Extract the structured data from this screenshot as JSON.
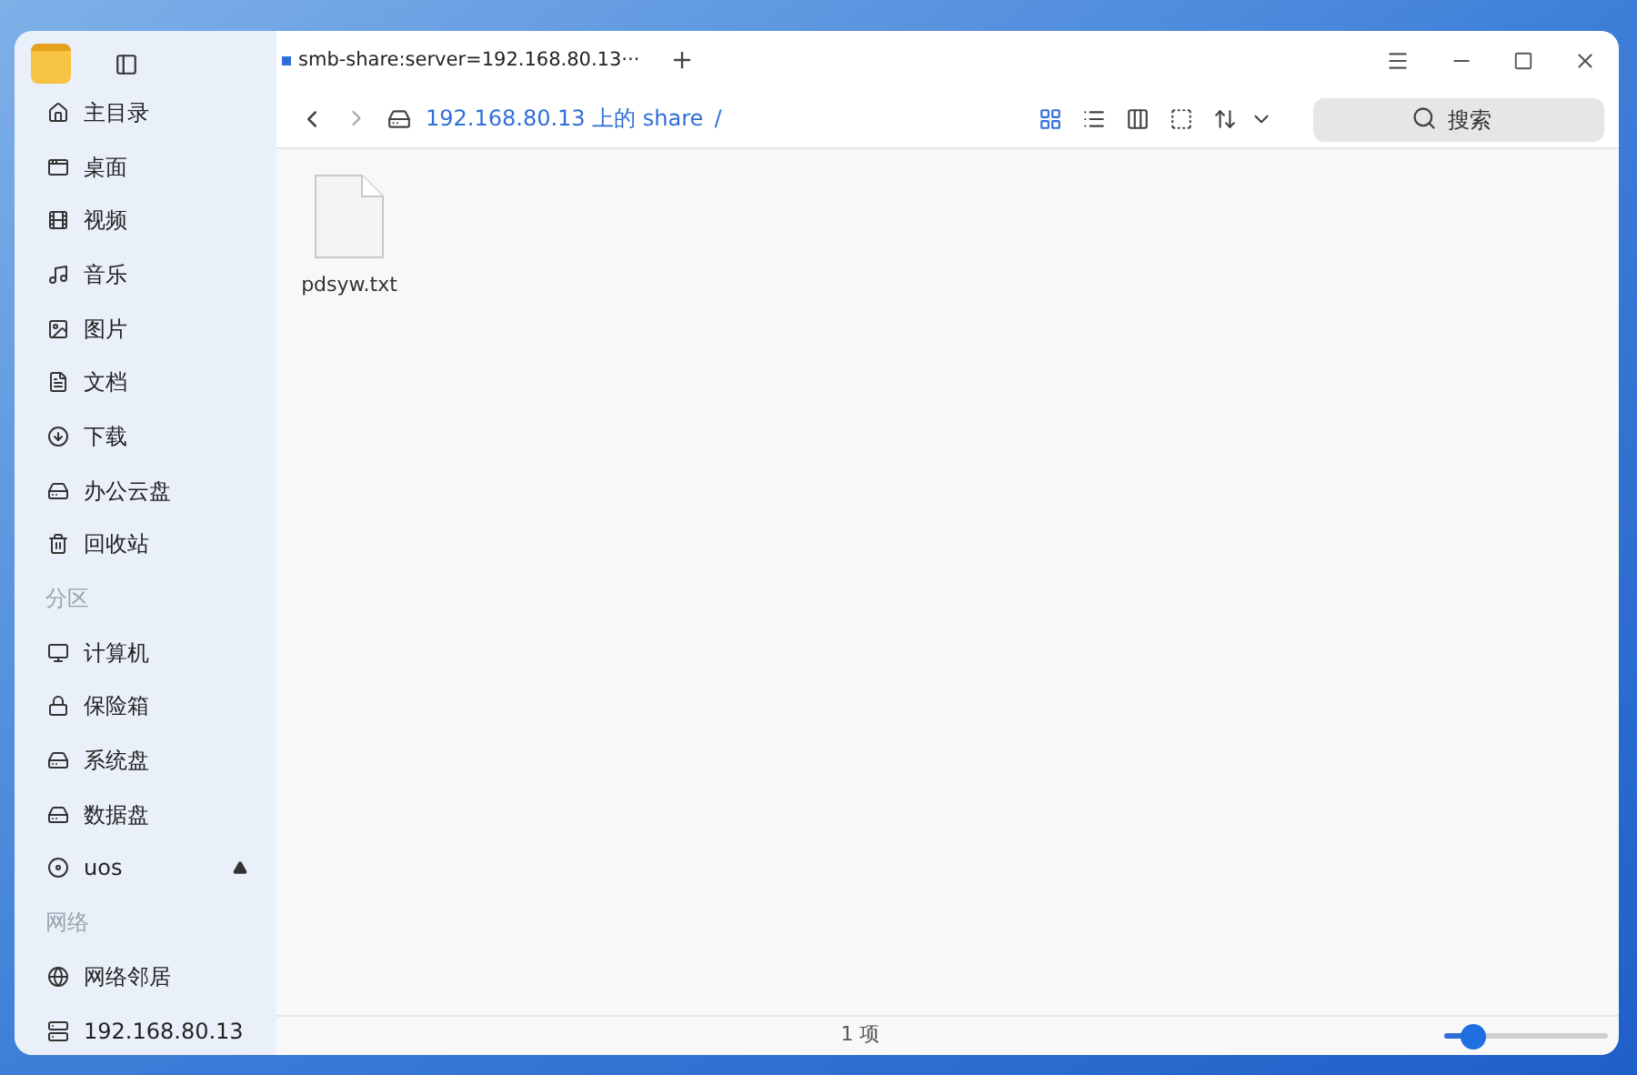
{
  "sidebar": {
    "items": [
      {
        "kind": "item",
        "label": "主目录"
      },
      {
        "kind": "item",
        "label": "桌面"
      },
      {
        "kind": "item",
        "label": "视频"
      },
      {
        "kind": "item",
        "label": "音乐"
      },
      {
        "kind": "item",
        "label": "图片"
      },
      {
        "kind": "item",
        "label": "文档"
      },
      {
        "kind": "item",
        "label": "下载"
      },
      {
        "kind": "item",
        "label": "办公云盘"
      },
      {
        "kind": "item",
        "label": "回收站"
      },
      {
        "kind": "heading",
        "label": "分区"
      },
      {
        "kind": "item",
        "label": "计算机"
      },
      {
        "kind": "item",
        "label": "保险箱"
      },
      {
        "kind": "item",
        "label": "系统盘"
      },
      {
        "kind": "item",
        "label": "数据盘"
      },
      {
        "kind": "item",
        "label": "uos",
        "eject": true
      },
      {
        "kind": "heading",
        "label": "网络"
      },
      {
        "kind": "item",
        "label": "网络邻居"
      },
      {
        "kind": "item",
        "label": "192.168.80.13"
      }
    ]
  },
  "tabs": [
    {
      "label": "smb-share:server=192.168.80.13···",
      "selected": true
    }
  ],
  "breadcrumb": {
    "path": "192.168.80.13 上的 share",
    "separator": "/"
  },
  "view_modes": [
    {
      "selected": true
    },
    {
      "selected": false
    },
    {
      "selected": false
    }
  ],
  "search": {
    "placeholder": "搜索"
  },
  "files": [
    {
      "name": "pdsyw.txt"
    }
  ],
  "status_bar": {
    "count": "1 项",
    "zoom": {
      "level": 0.18
    }
  }
}
